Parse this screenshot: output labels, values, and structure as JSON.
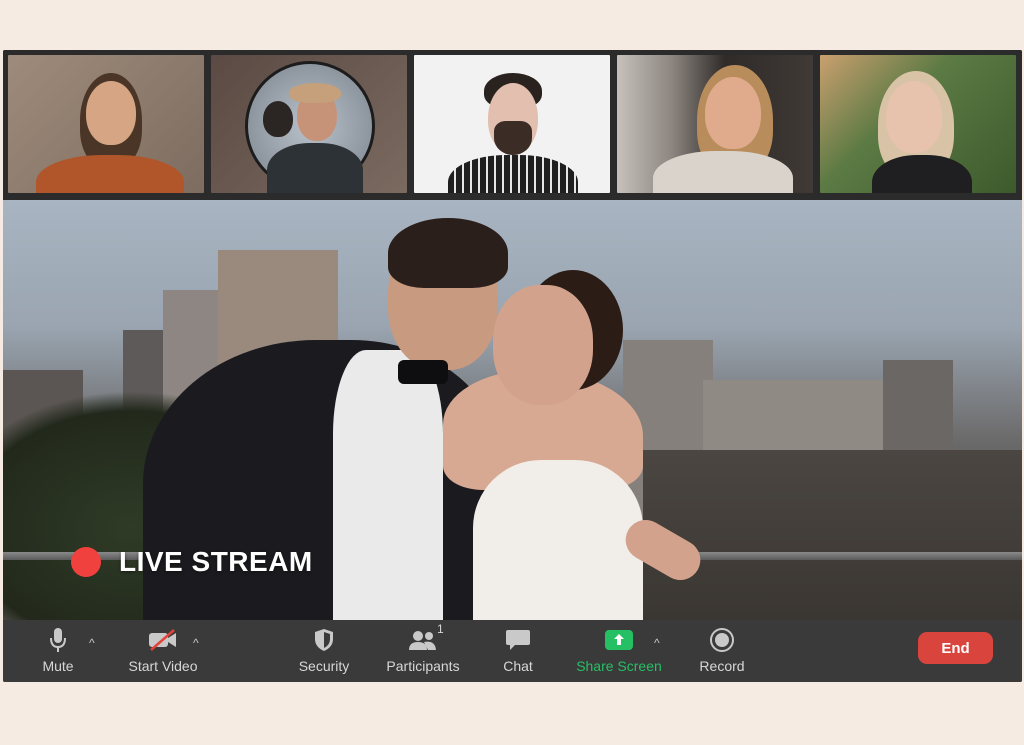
{
  "participants": [
    {
      "name": "participant-1",
      "bg": "#8f7a6a",
      "skin": "#d6a583",
      "hair": "#4a3526",
      "shirt": "#b0562a"
    },
    {
      "name": "participant-2",
      "bg": "#6b5a52",
      "skin": "#c69278",
      "hair": "#c6a07a",
      "shirt": "#2d3236"
    },
    {
      "name": "participant-3",
      "bg": "#f2f2f2",
      "skin": "#e2bfae",
      "hair": "#2a221f",
      "shirt": "#2b2b2b"
    },
    {
      "name": "participant-4",
      "bg": "#3b3633",
      "skin": "#e0ab8c",
      "hair": "#b88d5b",
      "shirt": "#d9d3cc"
    },
    {
      "name": "participant-5",
      "bg": "#5c7a44",
      "skin": "#e7c3ad",
      "hair": "#d9c3a6",
      "shirt": "#1f1f22"
    }
  ],
  "live_stream": {
    "label": "LIVE STREAM",
    "dot_color": "#f0413f"
  },
  "toolbar": {
    "mute": {
      "label": "Mute",
      "icon": "microphone-icon"
    },
    "start_video": {
      "label": "Start Video",
      "icon": "video-off-icon"
    },
    "security": {
      "label": "Security",
      "icon": "shield-icon"
    },
    "participants": {
      "label": "Participants",
      "icon": "people-icon",
      "count": "1"
    },
    "chat": {
      "label": "Chat",
      "icon": "chat-bubble-icon"
    },
    "share_screen": {
      "label": "Share Screen",
      "icon": "share-screen-icon",
      "color": "#25c064"
    },
    "record": {
      "label": "Record",
      "icon": "record-icon"
    },
    "end": {
      "label": "End",
      "color": "#d9443c"
    }
  },
  "caret_glyph": "^"
}
